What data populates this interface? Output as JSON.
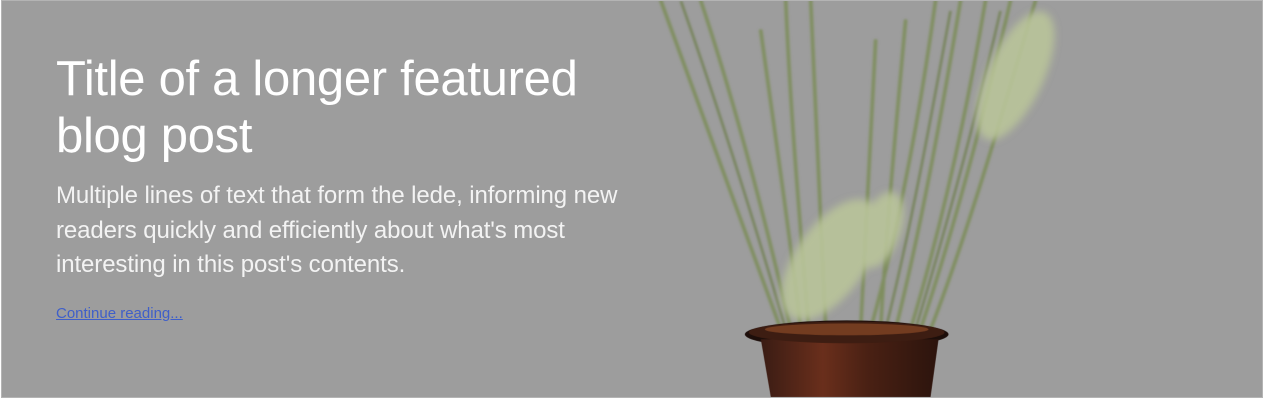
{
  "featured_post": {
    "title": "Title of a longer featured blog post",
    "lede": "Multiple lines of text that form the lede, informing new readers quickly and efficiently about what's most interesting in this post's contents.",
    "link_label": "Continue reading..."
  },
  "colors": {
    "background": "#9d9d9d",
    "title": "#ffffff",
    "lede": "#f3f3f3",
    "link": "#3f5fc9"
  },
  "background_image": {
    "subject": "dried grass stems in a dark amber vase"
  }
}
